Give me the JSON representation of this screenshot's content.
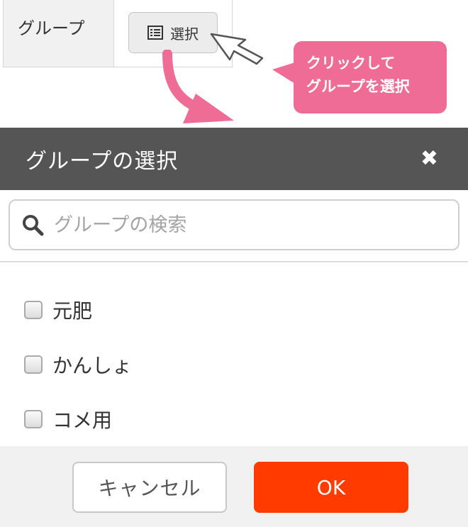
{
  "form": {
    "group_label": "グループ",
    "select_button_label": "選択",
    "select_icon": "list-icon"
  },
  "annotation": {
    "callout_line1": "クリックして",
    "callout_line2": "グループを選択",
    "callout_color": "#ee6c95"
  },
  "modal": {
    "title": "グループの選択",
    "close_label": "✖",
    "header_color": "#555555",
    "search": {
      "placeholder": "グループの検索",
      "icon": "search-icon"
    },
    "groups": [
      {
        "label": "元肥",
        "checked": false
      },
      {
        "label": "かんしょ",
        "checked": false
      },
      {
        "label": "コメ用",
        "checked": false
      }
    ],
    "footer": {
      "cancel_label": "キャンセル",
      "ok_label": "OK",
      "ok_color": "#ff3b00"
    }
  }
}
